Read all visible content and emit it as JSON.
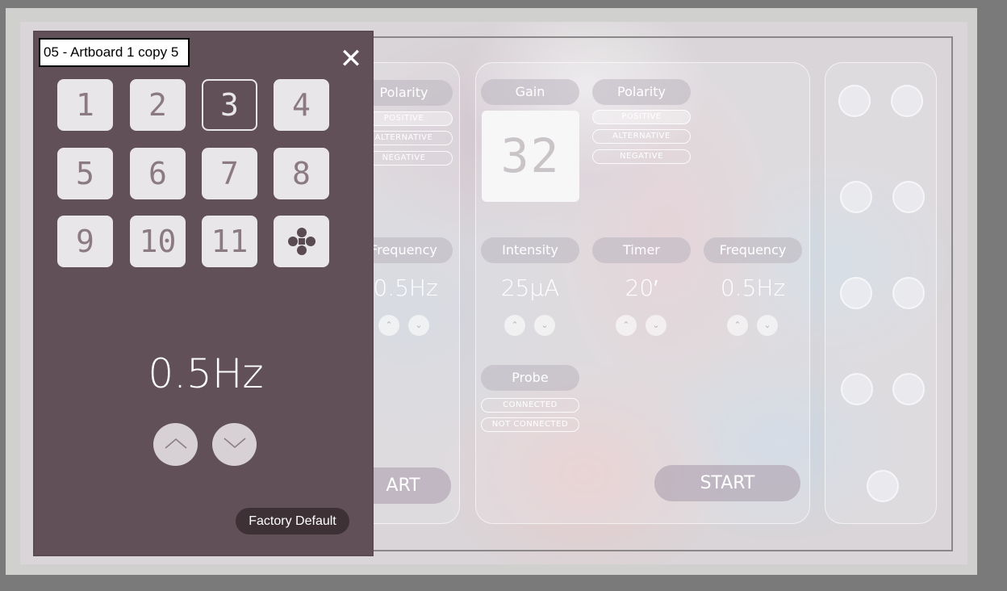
{
  "window": {
    "title": "05 - Artboard 1 copy 5"
  },
  "panel": {
    "close_icon": "close-icon",
    "keypad": [
      "1",
      "2",
      "3",
      "4",
      "5",
      "6",
      "7",
      "8",
      "9",
      "10",
      "11"
    ],
    "selected_key": "3",
    "special_key_icon": "four-point-star-icon",
    "value": "0.5Hz",
    "up_icon": "chevron-up-icon",
    "down_icon": "chevron-down-icon",
    "factory_default_label": "Factory Default"
  },
  "background": {
    "channel1": {
      "polarity_label": "Polarity",
      "polarity_options": [
        "POSITIVE",
        "ALTERNATIVE",
        "NEGATIVE"
      ],
      "selected_polarity": "POSITIVE",
      "frequency_label": "Frequency",
      "frequency_value": "0.5Hz",
      "start_label": "ART"
    },
    "channel2": {
      "gain_label": "Gain",
      "gain_value": "32",
      "polarity_label": "Polarity",
      "polarity_options": [
        "POSITIVE",
        "ALTERNATIVE",
        "NEGATIVE"
      ],
      "selected_polarity": "POSITIVE",
      "intensity_label": "Intensity",
      "intensity_value": "25µA",
      "timer_label": "Timer",
      "timer_value": "20′",
      "frequency_label": "Frequency",
      "frequency_value": "0.5Hz",
      "probe_label": "Probe",
      "probe_options": [
        "CONNECTED",
        "NOT CONNECTED"
      ],
      "start_label": "START"
    }
  },
  "colors": {
    "panel_bg": "#625058",
    "factory_button_bg": "#3e3136",
    "key_bg": "#e8e6e8"
  }
}
